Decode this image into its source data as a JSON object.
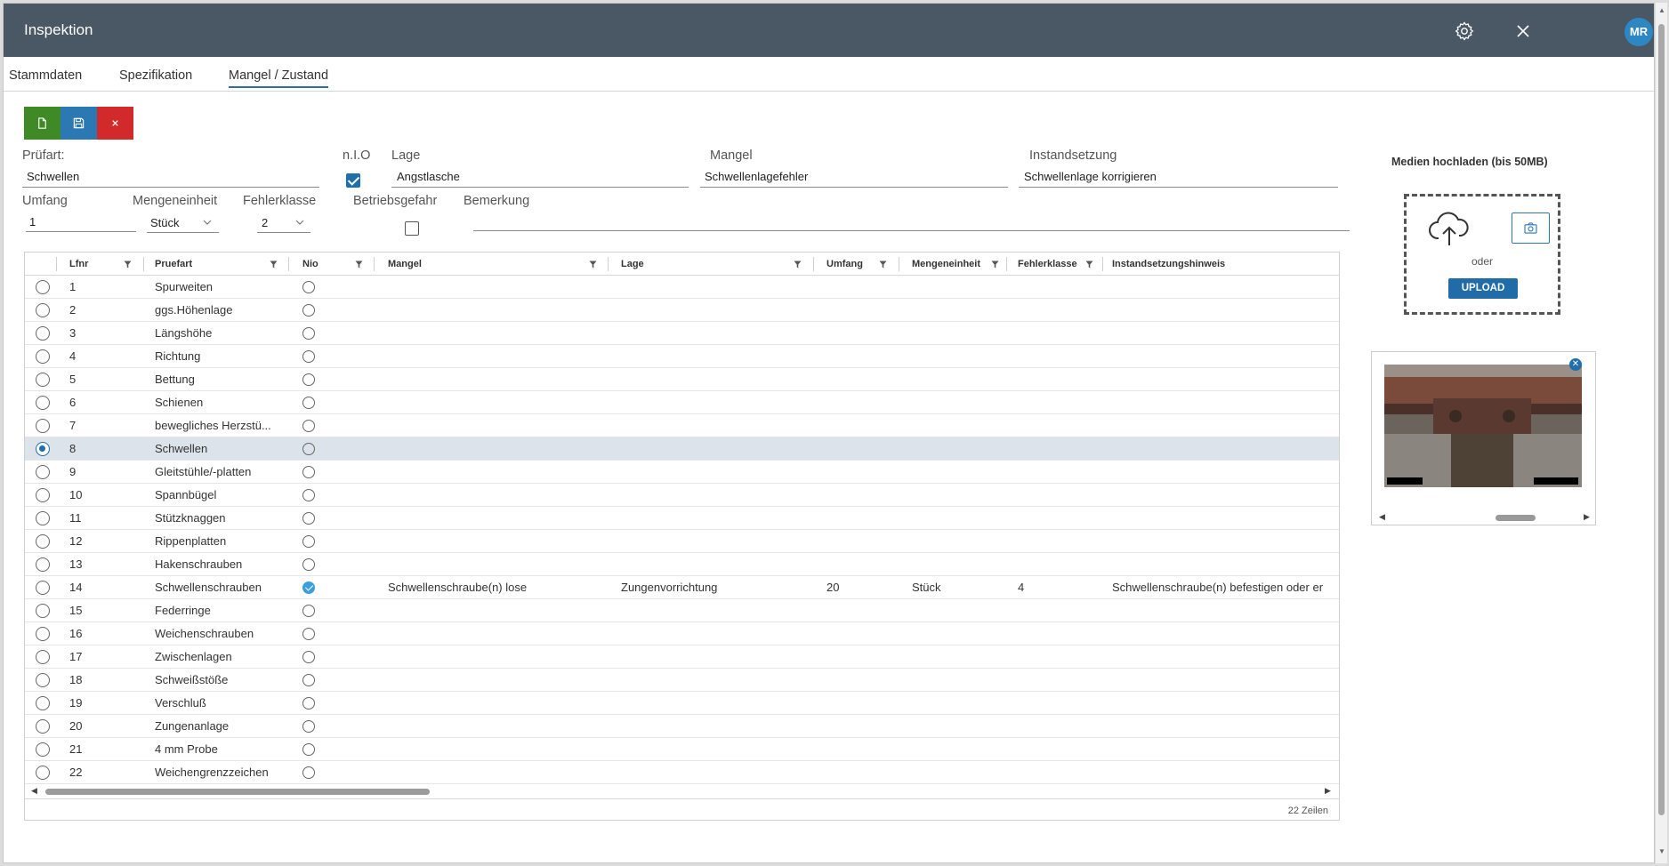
{
  "header": {
    "title": "Inspektion",
    "avatar_initials": "MR"
  },
  "tabs": [
    {
      "label": "Stammdaten"
    },
    {
      "label": "Spezifikation"
    },
    {
      "label": "Mangel / Zustand",
      "active": true
    }
  ],
  "toolbar": {
    "new_icon": "new-document-icon",
    "save_icon": "save-icon",
    "cancel_icon": "close-icon"
  },
  "form": {
    "pruefart_label": "Prüfart:",
    "pruefart_value": "Schwellen",
    "nio_label": "n.I.O",
    "nio_checked": true,
    "lage_label": "Lage",
    "lage_value": "Angstlasche",
    "mangel_label": "Mangel",
    "mangel_value": "Schwellenlagefehler",
    "instandsetzung_label": "Instandsetzung",
    "instandsetzung_value": "Schwellenlage korrigieren",
    "umfang_label": "Umfang",
    "umfang_value": "1",
    "mengeneinheit_label": "Mengeneinheit",
    "mengeneinheit_value": "Stück",
    "fehlerklasse_label": "Fehlerklasse",
    "fehlerklasse_value": "2",
    "betriebsgefahr_label": "Betriebsgefahr",
    "betriebsgefahr_checked": false,
    "bemerkung_label": "Bemerkung",
    "bemerkung_value": ""
  },
  "grid": {
    "columns": [
      "Lfnr",
      "Pruefart",
      "Nio",
      "Mangel",
      "Lage",
      "Umfang",
      "Mengeneinheit",
      "Fehlerklasse",
      "Instandsetzungshinweis"
    ],
    "rows": [
      {
        "lfnr": "1",
        "pruefart": "Spurweiten"
      },
      {
        "lfnr": "2",
        "pruefart": "ggs.Höhenlage"
      },
      {
        "lfnr": "3",
        "pruefart": "Längshöhe"
      },
      {
        "lfnr": "4",
        "pruefart": "Richtung"
      },
      {
        "lfnr": "5",
        "pruefart": "Bettung"
      },
      {
        "lfnr": "6",
        "pruefart": "Schienen"
      },
      {
        "lfnr": "7",
        "pruefart": "bewegliches Herzstü..."
      },
      {
        "lfnr": "8",
        "pruefart": "Schwellen",
        "selected": true
      },
      {
        "lfnr": "9",
        "pruefart": "Gleitstühle/-platten"
      },
      {
        "lfnr": "10",
        "pruefart": "Spannbügel"
      },
      {
        "lfnr": "11",
        "pruefart": "Stützknaggen"
      },
      {
        "lfnr": "12",
        "pruefart": "Rippenplatten"
      },
      {
        "lfnr": "13",
        "pruefart": "Hakenschrauben"
      },
      {
        "lfnr": "14",
        "pruefart": "Schwellenschrauben",
        "nio": true,
        "mangel": "Schwellenschraube(n) lose",
        "lage": "Zungenvorrichtung",
        "umfang": "20",
        "mengeneinheit": "Stück",
        "fehlerklasse": "4",
        "hinweis": "Schwellenschraube(n) befestigen oder er"
      },
      {
        "lfnr": "15",
        "pruefart": "Federringe"
      },
      {
        "lfnr": "16",
        "pruefart": "Weichenschrauben"
      },
      {
        "lfnr": "17",
        "pruefart": "Zwischenlagen"
      },
      {
        "lfnr": "18",
        "pruefart": "Schweißstöße"
      },
      {
        "lfnr": "19",
        "pruefart": "Verschluß"
      },
      {
        "lfnr": "20",
        "pruefart": "Zungenanlage"
      },
      {
        "lfnr": "21",
        "pruefart": "4 mm Probe"
      },
      {
        "lfnr": "22",
        "pruefart": "Weichengrenzzeichen"
      }
    ],
    "row_count_label": "22 Zeilen"
  },
  "upload": {
    "title": "Medien hochladen (bis 50MB)",
    "or_label": "oder",
    "button_label": "UPLOAD"
  }
}
